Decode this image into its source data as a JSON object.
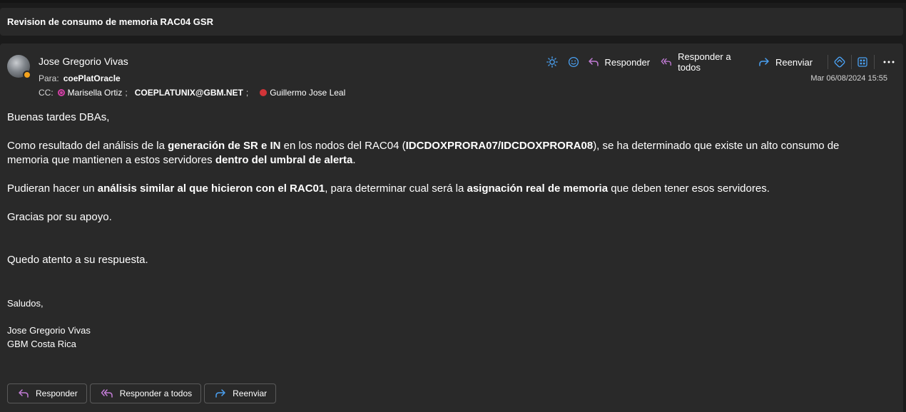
{
  "subject": "Revision de consumo de memoria RAC04 GSR",
  "header": {
    "sender": "Jose Gregorio Vivas",
    "to_label": "Para:",
    "to": "coePlatOracle",
    "cc_label": "CC:",
    "cc": [
      {
        "name": "Marisella Ortiz",
        "sep": ";"
      },
      {
        "name": "COEPLATUNIX@GBM.NET",
        "sep": ";"
      },
      {
        "name": "Guillermo Jose Leal",
        "sep": ""
      }
    ],
    "date": "Mar 06/08/2024 15:55"
  },
  "toolbar": {
    "reply_label": "Responder",
    "reply_all_label": "Responder a todos",
    "forward_label": "Reenviar"
  },
  "body": {
    "greeting": "Buenas tardes DBAs,",
    "p1_a": "Como resultado del análisis de la ",
    "p1_b": "generación de SR e IN",
    "p1_c": " en los nodos del RAC04 (",
    "p1_d": "IDCDOXPRORA07/IDCDOXPRORA08",
    "p1_e": "), se ha determinado que existe un alto consumo de memoria que mantienen a estos servidores ",
    "p1_f": "dentro del umbral de alerta",
    "p1_g": ".",
    "p2_a": "Pudieran hacer un ",
    "p2_b": "análisis similar al que hicieron con el RAC01",
    "p2_c": ", para determinar cual será la ",
    "p2_d": "asignación real de memoria",
    "p2_e": " que deben tener esos servidores.",
    "p3": "Gracias por su apoyo.",
    "p4": "Quedo atento a su respuesta.",
    "closing": "Saludos,",
    "sig_name": "Jose Gregorio Vivas",
    "sig_company": "GBM Costa Rica"
  },
  "bottom": {
    "reply_label": "Responder",
    "reply_all_label": "Responder a todos",
    "forward_label": "Reenviar"
  },
  "colors": {
    "accent_reply": "#c27cd6",
    "accent_forward": "#4aa1f3",
    "presence_away": "#f4a21c",
    "cc_ring": "#d03fa4",
    "cc_red": "#d13438"
  }
}
